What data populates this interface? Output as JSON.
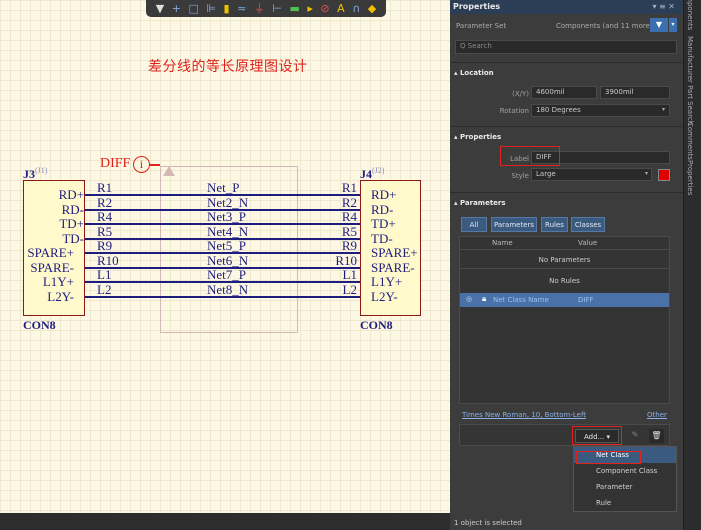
{
  "toolbar": {
    "icons": [
      "filter-icon",
      "plus-icon",
      "select-rect-icon",
      "align-icon",
      "tag-icon",
      "wire-icon",
      "gnd-icon",
      "port-icon",
      "bus-icon",
      "part-icon",
      "directive-icon",
      "text-icon",
      "arc-icon",
      "more-icon"
    ]
  },
  "schematic": {
    "title": "差分线的等长原理图设计",
    "diff": {
      "label": "DIFF",
      "icon_glyph": "i"
    },
    "j3": {
      "name": "J3",
      "sup": "(J1)",
      "pins": [
        "RD+",
        "RD-",
        "TD+",
        "TD-",
        "SPARE+",
        "SPARE-",
        "L1Y+",
        "L2Y-"
      ],
      "footer": "CON8"
    },
    "j4": {
      "name": "J4",
      "sup": "(J2)",
      "pins": [
        "RD+",
        "RD-",
        "TD+",
        "TD-",
        "SPARE+",
        "SPARE-",
        "L1Y+",
        "L2Y-"
      ],
      "footer": "CON8"
    },
    "resistors_left": [
      "R1",
      "R2",
      "R4",
      "R5",
      "R9",
      "R10",
      "L1",
      "L2"
    ],
    "resistors_right": [
      "R1",
      "R2",
      "R4",
      "R5",
      "R9",
      "R10",
      "L1",
      "L2"
    ],
    "nets": [
      "Net_P",
      "Net2_N",
      "Net3_P",
      "Net4_N",
      "Net5_P",
      "Net6_N",
      "Net7_P",
      "Net8_N"
    ]
  },
  "panel": {
    "title": "Properties",
    "header_icons": "▾ ≡ ✕",
    "parameter_set_label": "Parameter Set",
    "parameter_set_value": "Components (and 11 more)",
    "search_placeholder": "Q  Search",
    "location": {
      "heading": "▴ Location",
      "xy_label": "(X/Y)",
      "x": "4600mil",
      "y": "3900mil",
      "rotation_label": "Rotation",
      "rotation": "180 Degrees"
    },
    "properties": {
      "heading": "▴ Properties",
      "label_label": "Label",
      "label_value": "DIFF",
      "style_label": "Style",
      "style_value": "Large",
      "style_color": "#e00000"
    },
    "parameters": {
      "heading": "▴ Parameters",
      "tabs": [
        "All",
        "Parameters",
        "Rules",
        "Classes"
      ],
      "columns": [
        "Name",
        "Value"
      ],
      "no_parameters": "No Parameters",
      "no_rules": "No Rules",
      "row": {
        "name": "Net Class Name",
        "value": "DIFF"
      },
      "font_link": "Times New Roman, 10, Bottom-Left",
      "other": "Other",
      "add_button": "Add... ▾"
    },
    "menu": [
      "Net Class",
      "Component Class",
      "Parameter",
      "Rule"
    ],
    "status": "1 object is selected"
  },
  "side_tabs": [
    "Components",
    "Manufacturer Part Search",
    "Comments",
    "Properties"
  ],
  "colors": {
    "accent": "#3b5a80",
    "wire": "#1d1d80",
    "red": "#e0211c",
    "sheet": "#fdf8e4"
  }
}
